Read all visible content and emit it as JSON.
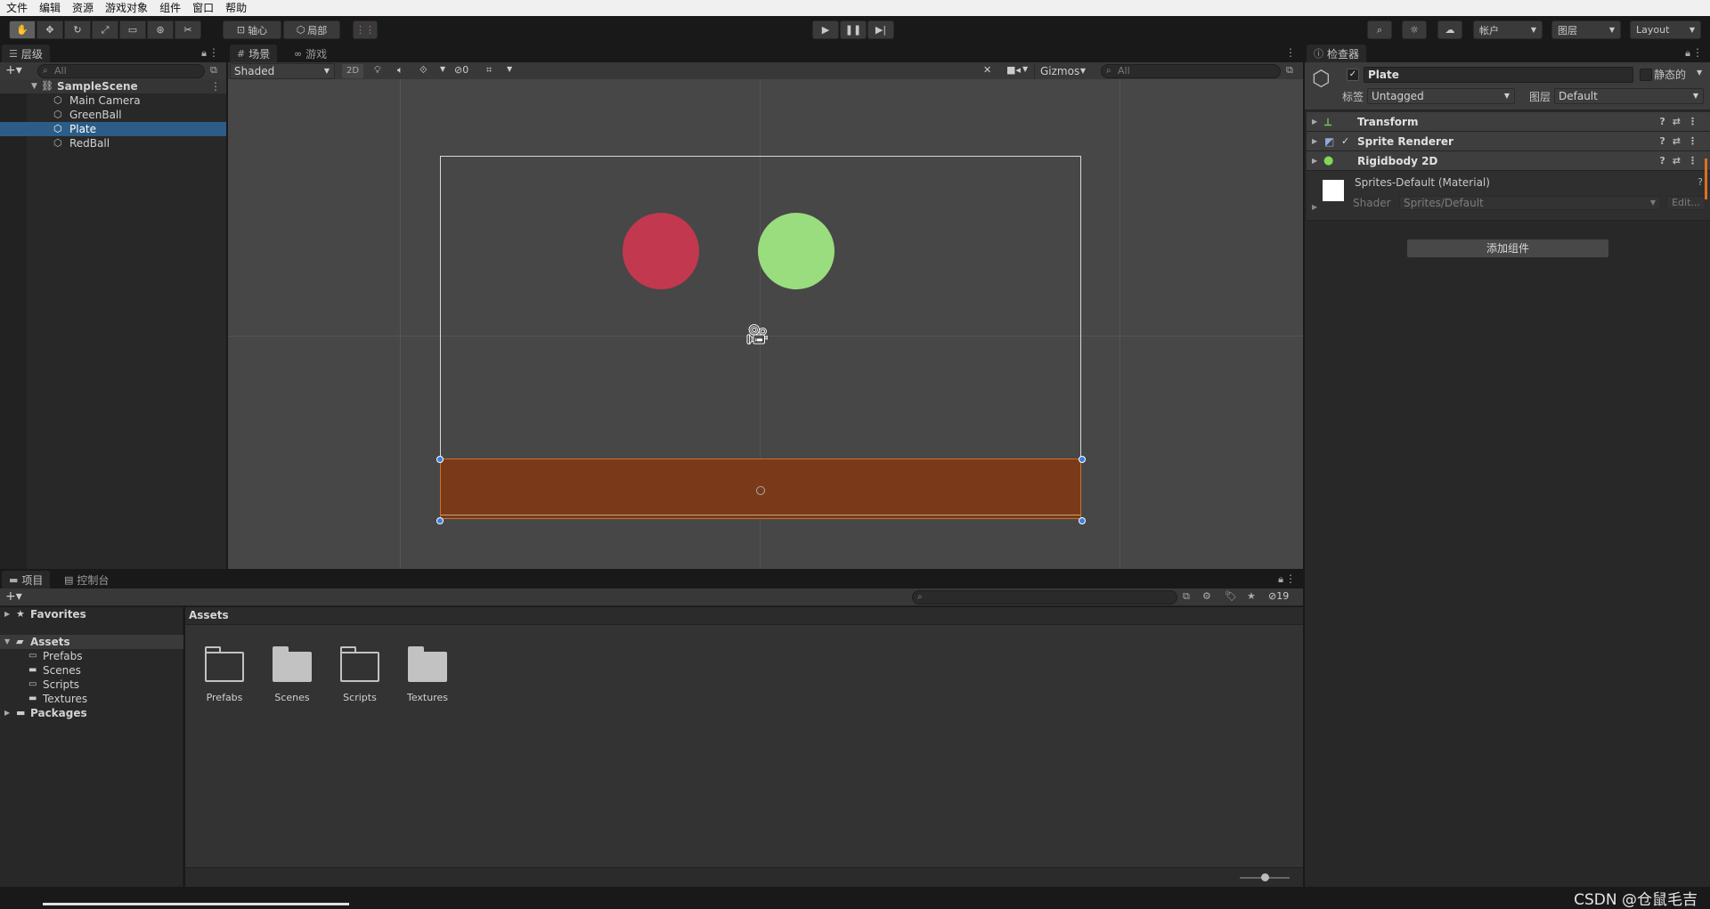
{
  "menu": [
    "文件",
    "编辑",
    "资源",
    "游戏对象",
    "组件",
    "窗口",
    "帮助"
  ],
  "toolbar": {
    "pivot_label": "轴心",
    "local_label": "局部",
    "account_label": "帐户",
    "layers_label": "图层",
    "layout_label": "Layout",
    "play_icon": "play-icon",
    "pause_icon": "pause-icon",
    "step_icon": "step-icon"
  },
  "hierarchy": {
    "tab_label": "层级",
    "search_placeholder": "All",
    "scene_name": "SampleScene",
    "items": [
      {
        "label": "Main Camera"
      },
      {
        "label": "GreenBall"
      },
      {
        "label": "Plate"
      },
      {
        "label": "RedBall"
      }
    ],
    "selected": "Plate"
  },
  "scene": {
    "tab_scene": "场景",
    "tab_game": "游戏",
    "shading_mode": "Shaded",
    "mode_2d": "2D",
    "hidden_count": "0",
    "gizmos_label": "Gizmos",
    "search_placeholder": "All",
    "colors": {
      "red_ball": "#c2384e",
      "green_ball": "#99dd7f",
      "plate": "#7a3a1a",
      "background": "#474747"
    }
  },
  "inspector": {
    "tab_label": "检查器",
    "object_name": "Plate",
    "static_label": "静态的",
    "tag_label": "标签",
    "tag_value": "Untagged",
    "layer_label": "图层",
    "layer_value": "Default",
    "components": [
      {
        "name": "Transform",
        "icon": "transform-icon"
      },
      {
        "name": "Sprite Renderer",
        "icon": "sprite-renderer-icon"
      },
      {
        "name": "Rigidbody 2D",
        "icon": "rigidbody2d-icon"
      }
    ],
    "material_name": "Sprites-Default (Material)",
    "shader_label": "Shader",
    "shader_value": "Sprites/Default",
    "edit_label": "Edit...",
    "add_component_label": "添加组件"
  },
  "project": {
    "tab_project": "项目",
    "tab_console": "控制台",
    "hidden_count": "19",
    "breadcrumb": "Assets",
    "tree": {
      "favorites": "Favorites",
      "assets": "Assets",
      "children": [
        "Prefabs",
        "Scenes",
        "Scripts",
        "Textures"
      ],
      "packages": "Packages"
    },
    "folders": [
      {
        "label": "Prefabs",
        "style": "outline"
      },
      {
        "label": "Scenes",
        "style": "filled"
      },
      {
        "label": "Scripts",
        "style": "outline"
      },
      {
        "label": "Textures",
        "style": "filled"
      }
    ]
  },
  "watermark": "CSDN @仓鼠毛吉"
}
